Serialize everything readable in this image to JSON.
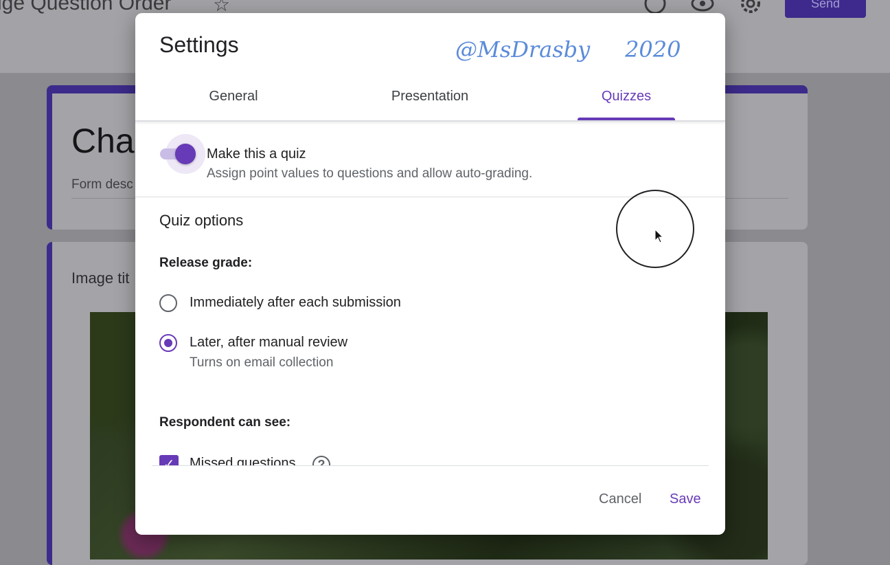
{
  "background": {
    "form_title": "ige Question Order",
    "send_label": "Send",
    "header_card_title": "Char",
    "header_card_description": "Form desc",
    "image_card_title": "Image tit"
  },
  "dialog": {
    "title": "Settings",
    "watermark": "@MsDrasby     2020",
    "tabs": [
      {
        "label": "General",
        "active": false
      },
      {
        "label": "Presentation",
        "active": false
      },
      {
        "label": "Quizzes",
        "active": true
      }
    ],
    "quiz_toggle": {
      "label": "Make this a quiz",
      "description": "Assign point values to questions and allow auto-grading.",
      "enabled": true
    },
    "quiz_options": {
      "title": "Quiz options",
      "release_grade": {
        "label": "Release grade:",
        "options": [
          {
            "label": "Immediately after each submission",
            "selected": false
          },
          {
            "label": "Later, after manual review",
            "sublabel": "Turns on email collection",
            "selected": true
          }
        ]
      },
      "respondent_can_see": {
        "label": "Respondent can see:",
        "items": [
          {
            "label": "Missed questions",
            "checked": true
          }
        ]
      }
    },
    "footer": {
      "cancel_label": "Cancel",
      "save_label": "Save"
    }
  },
  "colors": {
    "accent": "#673ab7",
    "text_primary": "#202124",
    "text_secondary": "#5f6368",
    "watermark": "#5b8bd9"
  }
}
